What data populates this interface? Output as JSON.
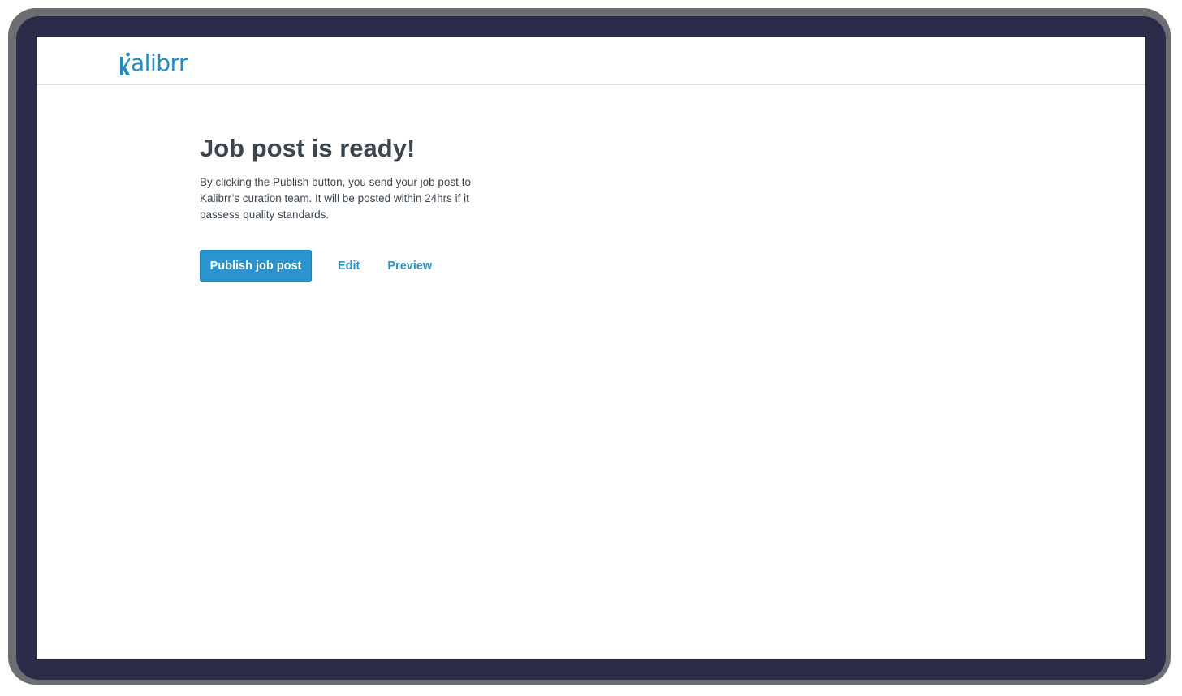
{
  "brand": {
    "name": "Kalibrr",
    "logo_text": "alibrr",
    "color": "#1f8dc5"
  },
  "main": {
    "title": "Job post is ready!",
    "description": "By clicking the Publish button, you send your job post to Kalibrr’s curation team. It will be posted within 24hrs if it passess quality standards.",
    "publish_label": "Publish job post",
    "edit_label": "Edit",
    "preview_label": "Preview"
  },
  "colors": {
    "accent": "#2b93cf",
    "text": "#3c4650",
    "divider": "#d9dce0"
  }
}
